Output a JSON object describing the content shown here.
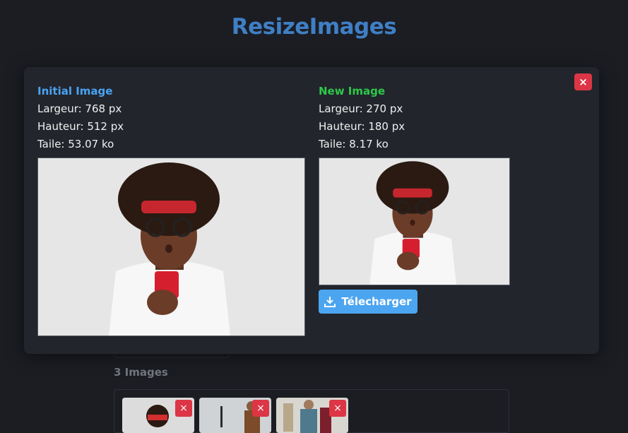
{
  "app": {
    "title": "ResizeImages"
  },
  "gallery": {
    "count_label": "3 Images",
    "thumbnails": [
      {
        "remove_glyph": "×"
      },
      {
        "remove_glyph": "×"
      },
      {
        "remove_glyph": "×"
      }
    ]
  },
  "modal": {
    "close_glyph": "×",
    "initial": {
      "heading": "Initial Image",
      "width_line": "Largeur: 768 px",
      "height_line": "Hauteur: 512 px",
      "size_line": "Taile: 53.07 ko"
    },
    "resized": {
      "heading": "New Image",
      "width_line": "Largeur: 270 px",
      "height_line": "Hauteur: 180 px",
      "size_line": "Taile: 8.17 ko",
      "download_label": "Télecharger"
    }
  },
  "colors": {
    "initial_heading": "#4aa3f2",
    "new_heading": "#2ec84a",
    "close_button": "#dc3545",
    "download_button": "#4ca5f0"
  },
  "icons": {
    "download": "download-icon",
    "close": "close-icon"
  }
}
